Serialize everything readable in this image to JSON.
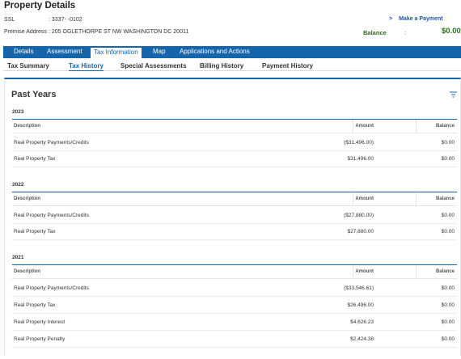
{
  "header": {
    "title": "Property Details",
    "ssl_label": "SSL",
    "ssl_value": ": 3337- -0102",
    "address_label": "Premise Address",
    "address_value": ": 205 OGLETHORPE ST NW WASHINGTON DC 20011",
    "make_payment": "Make a Payment",
    "balance_label": "Balance",
    "balance_colon": ":",
    "balance_value": "$0.00"
  },
  "main_tabs": [
    "Details",
    "Assessment",
    "Tax Information",
    "Map",
    "Applications and Actions"
  ],
  "active_main_tab": "Tax Information",
  "sub_tabs": [
    "Tax Summary",
    "Tax History",
    "Special Assessments",
    "Billing History",
    "Payment History"
  ],
  "active_sub_tab": "Tax History",
  "panel": {
    "title": "Past Years"
  },
  "table_headers": {
    "description": "Description",
    "amount": "Amount",
    "balance": "Balance"
  },
  "years": [
    {
      "year": "2023",
      "rows": [
        {
          "description": "Real Property Payments/Credits",
          "amount": "($31,496.00)",
          "balance": "$0.00"
        },
        {
          "description": "Real Property Tax",
          "amount": "$31,496.00",
          "balance": "$0.00"
        }
      ]
    },
    {
      "year": "2022",
      "rows": [
        {
          "description": "Real Property Payments/Credits",
          "amount": "($27,880.00)",
          "balance": "$0.00"
        },
        {
          "description": "Real Property Tax",
          "amount": "$27,880.00",
          "balance": "$0.00"
        }
      ]
    },
    {
      "year": "2021",
      "rows": [
        {
          "description": "Real Property Payments/Credits",
          "amount": "($33,546.61)",
          "balance": "$0.00"
        },
        {
          "description": "Real Property Tax",
          "amount": "$26,496.00",
          "balance": "$0.00"
        },
        {
          "description": "Real Property Interest",
          "amount": "$4,626.23",
          "balance": "$0.00"
        },
        {
          "description": "Real Property Penalty",
          "amount": "$2,424.38",
          "balance": "$0.00"
        }
      ]
    }
  ],
  "colors": {
    "primary": "#1565ad",
    "balance_green": "#2e6b1f"
  },
  "icons": {
    "payment_chevron": "chevron-right-icon",
    "filter": "filter-icon"
  }
}
